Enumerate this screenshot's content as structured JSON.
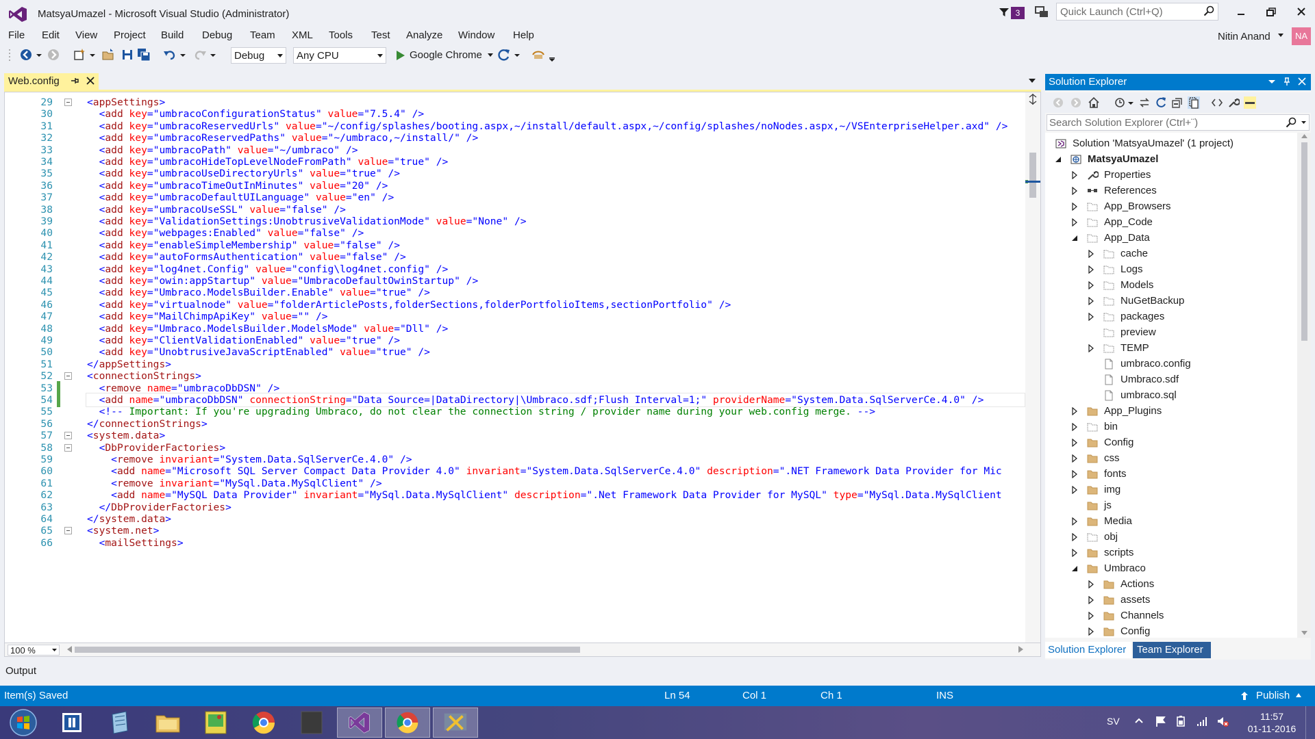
{
  "window": {
    "title": "MatsyaUmazel - Microsoft Visual Studio (Administrator)",
    "notification_count": "3",
    "quick_launch_placeholder": "Quick Launch (Ctrl+Q)"
  },
  "menu": {
    "items": [
      "File",
      "Edit",
      "View",
      "Project",
      "Build",
      "Debug",
      "Team",
      "XML",
      "Tools",
      "Test",
      "Analyze",
      "Window",
      "Help"
    ],
    "user_name": "Nitin Anand",
    "avatar_initials": "NA"
  },
  "toolbar": {
    "configuration": "Debug",
    "platform": "Any CPU",
    "run_target": "Google Chrome"
  },
  "editor": {
    "tab_label": "Web.config",
    "zoom": "100 %",
    "lines": [
      {
        "n": "29",
        "text": "<appSettings>"
      },
      {
        "n": "30",
        "text": "  <add key=\"umbracoConfigurationStatus\" value=\"7.5.4\" />"
      },
      {
        "n": "31",
        "text": "  <add key=\"umbracoReservedUrls\" value=\"~/config/splashes/booting.aspx,~/install/default.aspx,~/config/splashes/noNodes.aspx,~/VSEnterpriseHelper.axd\" />"
      },
      {
        "n": "32",
        "text": "  <add key=\"umbracoReservedPaths\" value=\"~/umbraco,~/install/\" />"
      },
      {
        "n": "33",
        "text": "  <add key=\"umbracoPath\" value=\"~/umbraco\" />"
      },
      {
        "n": "34",
        "text": "  <add key=\"umbracoHideTopLevelNodeFromPath\" value=\"true\" />"
      },
      {
        "n": "35",
        "text": "  <add key=\"umbracoUseDirectoryUrls\" value=\"true\" />"
      },
      {
        "n": "36",
        "text": "  <add key=\"umbracoTimeOutInMinutes\" value=\"20\" />"
      },
      {
        "n": "37",
        "text": "  <add key=\"umbracoDefaultUILanguage\" value=\"en\" />"
      },
      {
        "n": "38",
        "text": "  <add key=\"umbracoUseSSL\" value=\"false\" />"
      },
      {
        "n": "39",
        "text": "  <add key=\"ValidationSettings:UnobtrusiveValidationMode\" value=\"None\" />"
      },
      {
        "n": "40",
        "text": "  <add key=\"webpages:Enabled\" value=\"false\" />"
      },
      {
        "n": "41",
        "text": "  <add key=\"enableSimpleMembership\" value=\"false\" />"
      },
      {
        "n": "42",
        "text": "  <add key=\"autoFormsAuthentication\" value=\"false\" />"
      },
      {
        "n": "43",
        "text": "  <add key=\"log4net.Config\" value=\"config\\log4net.config\" />"
      },
      {
        "n": "44",
        "text": "  <add key=\"owin:appStartup\" value=\"UmbracoDefaultOwinStartup\" />"
      },
      {
        "n": "45",
        "text": "  <add key=\"Umbraco.ModelsBuilder.Enable\" value=\"true\" />"
      },
      {
        "n": "46",
        "text": "  <add key=\"virtualnode\" value=\"folderArticlePosts,folderSections,folderPortfolioItems,sectionPortfolio\" />"
      },
      {
        "n": "47",
        "text": "  <add key=\"MailChimpApiKey\" value=\"\" />"
      },
      {
        "n": "48",
        "text": "  <add key=\"Umbraco.ModelsBuilder.ModelsMode\" value=\"Dll\" />"
      },
      {
        "n": "49",
        "text": "  <add key=\"ClientValidationEnabled\" value=\"true\" />"
      },
      {
        "n": "50",
        "text": "  <add key=\"UnobtrusiveJavaScriptEnabled\" value=\"true\" />"
      },
      {
        "n": "51",
        "text": "</appSettings>"
      },
      {
        "n": "52",
        "text": "<connectionStrings>"
      },
      {
        "n": "53",
        "text": "  <remove name=\"umbracoDbDSN\" />"
      },
      {
        "n": "54",
        "text": "  <add name=\"umbracoDbDSN\" connectionString=\"Data Source=|DataDirectory|\\Umbraco.sdf;Flush Interval=1;\" providerName=\"System.Data.SqlServerCe.4.0\" />"
      },
      {
        "n": "55",
        "text": "  <!-- Important: If you're upgrading Umbraco, do not clear the connection string / provider name during your web.config merge. -->"
      },
      {
        "n": "56",
        "text": "</connectionStrings>"
      },
      {
        "n": "57",
        "text": "<system.data>"
      },
      {
        "n": "58",
        "text": "  <DbProviderFactories>"
      },
      {
        "n": "59",
        "text": "    <remove invariant=\"System.Data.SqlServerCe.4.0\" />"
      },
      {
        "n": "60",
        "text": "    <add name=\"Microsoft SQL Server Compact Data Provider 4.0\" invariant=\"System.Data.SqlServerCe.4.0\" description=\".NET Framework Data Provider for Micr"
      },
      {
        "n": "61",
        "text": "    <remove invariant=\"MySql.Data.MySqlClient\" />"
      },
      {
        "n": "62",
        "text": "    <add name=\"MySQL Data Provider\" invariant=\"MySql.Data.MySqlClient\" description=\".Net Framework Data Provider for MySQL\" type=\"MySql.Data.MySqlClient."
      },
      {
        "n": "63",
        "text": "  </DbProviderFactories>"
      },
      {
        "n": "64",
        "text": "</system.data>"
      },
      {
        "n": "65",
        "text": "<system.net>"
      },
      {
        "n": "66",
        "text": "  <mailSettings>"
      }
    ]
  },
  "solution_explorer": {
    "title": "Solution Explorer",
    "search_placeholder": "Search Solution Explorer (Ctrl+¨)",
    "tree": [
      {
        "label": "Solution 'MatsyaUmazel' (1 project)",
        "depth": 0,
        "exp": "none",
        "icon": "solution-icon"
      },
      {
        "label": "MatsyaUmazel",
        "depth": 0,
        "exp": "open",
        "icon": "web-project-icon",
        "bold": true
      },
      {
        "label": "Properties",
        "depth": 1,
        "exp": "closed",
        "icon": "wrench-icon"
      },
      {
        "label": "References",
        "depth": 1,
        "exp": "closed",
        "icon": "references-icon"
      },
      {
        "label": "App_Browsers",
        "depth": 1,
        "exp": "closed",
        "icon": "dotted-folder-icon"
      },
      {
        "label": "App_Code",
        "depth": 1,
        "exp": "closed",
        "icon": "dotted-folder-icon"
      },
      {
        "label": "App_Data",
        "depth": 1,
        "exp": "open",
        "icon": "dotted-folder-icon"
      },
      {
        "label": "cache",
        "depth": 2,
        "exp": "closed",
        "icon": "dotted-folder-icon"
      },
      {
        "label": "Logs",
        "depth": 2,
        "exp": "closed",
        "icon": "dotted-folder-icon"
      },
      {
        "label": "Models",
        "depth": 2,
        "exp": "closed",
        "icon": "dotted-folder-icon"
      },
      {
        "label": "NuGetBackup",
        "depth": 2,
        "exp": "closed",
        "icon": "dotted-folder-icon"
      },
      {
        "label": "packages",
        "depth": 2,
        "exp": "closed",
        "icon": "dotted-folder-icon"
      },
      {
        "label": "preview",
        "depth": 2,
        "exp": "none",
        "icon": "dotted-folder-icon"
      },
      {
        "label": "TEMP",
        "depth": 2,
        "exp": "closed",
        "icon": "dotted-folder-icon"
      },
      {
        "label": "umbraco.config",
        "depth": 2,
        "exp": "none",
        "icon": "file-icon"
      },
      {
        "label": "Umbraco.sdf",
        "depth": 2,
        "exp": "none",
        "icon": "file-icon"
      },
      {
        "label": "umbraco.sql",
        "depth": 2,
        "exp": "none",
        "icon": "file-icon"
      },
      {
        "label": "App_Plugins",
        "depth": 1,
        "exp": "closed",
        "icon": "folder-icon"
      },
      {
        "label": "bin",
        "depth": 1,
        "exp": "closed",
        "icon": "dotted-folder-icon"
      },
      {
        "label": "Config",
        "depth": 1,
        "exp": "closed",
        "icon": "folder-icon"
      },
      {
        "label": "css",
        "depth": 1,
        "exp": "closed",
        "icon": "folder-icon"
      },
      {
        "label": "fonts",
        "depth": 1,
        "exp": "closed",
        "icon": "folder-icon"
      },
      {
        "label": "img",
        "depth": 1,
        "exp": "closed",
        "icon": "folder-icon"
      },
      {
        "label": "js",
        "depth": 1,
        "exp": "none",
        "icon": "folder-icon"
      },
      {
        "label": "Media",
        "depth": 1,
        "exp": "closed",
        "icon": "folder-icon"
      },
      {
        "label": "obj",
        "depth": 1,
        "exp": "closed",
        "icon": "dotted-folder-icon"
      },
      {
        "label": "scripts",
        "depth": 1,
        "exp": "closed",
        "icon": "folder-icon"
      },
      {
        "label": "Umbraco",
        "depth": 1,
        "exp": "open",
        "icon": "folder-icon"
      },
      {
        "label": "Actions",
        "depth": 2,
        "exp": "closed",
        "icon": "folder-icon"
      },
      {
        "label": "assets",
        "depth": 2,
        "exp": "closed",
        "icon": "folder-icon"
      },
      {
        "label": "Channels",
        "depth": 2,
        "exp": "closed",
        "icon": "folder-icon"
      },
      {
        "label": "Config",
        "depth": 2,
        "exp": "closed",
        "icon": "folder-icon"
      }
    ],
    "tab_solution": "Solution Explorer",
    "tab_team": "Team Explorer"
  },
  "output": {
    "label": "Output"
  },
  "status": {
    "message": "Item(s) Saved",
    "line": "Ln 54",
    "col": "Col 1",
    "ch": "Ch 1",
    "mode": "INS",
    "publish": "Publish"
  },
  "taskbar": {
    "language": "SV",
    "time": "11:57",
    "date": "01-11-2016"
  },
  "colors": {
    "accent": "#007acc",
    "vs_purple": "#68217a",
    "tab_active": "#fff29d",
    "xml_element": "#a31515",
    "xml_attr": "#ff0000",
    "xml_value": "#0000ff",
    "xml_comment": "#008000"
  }
}
